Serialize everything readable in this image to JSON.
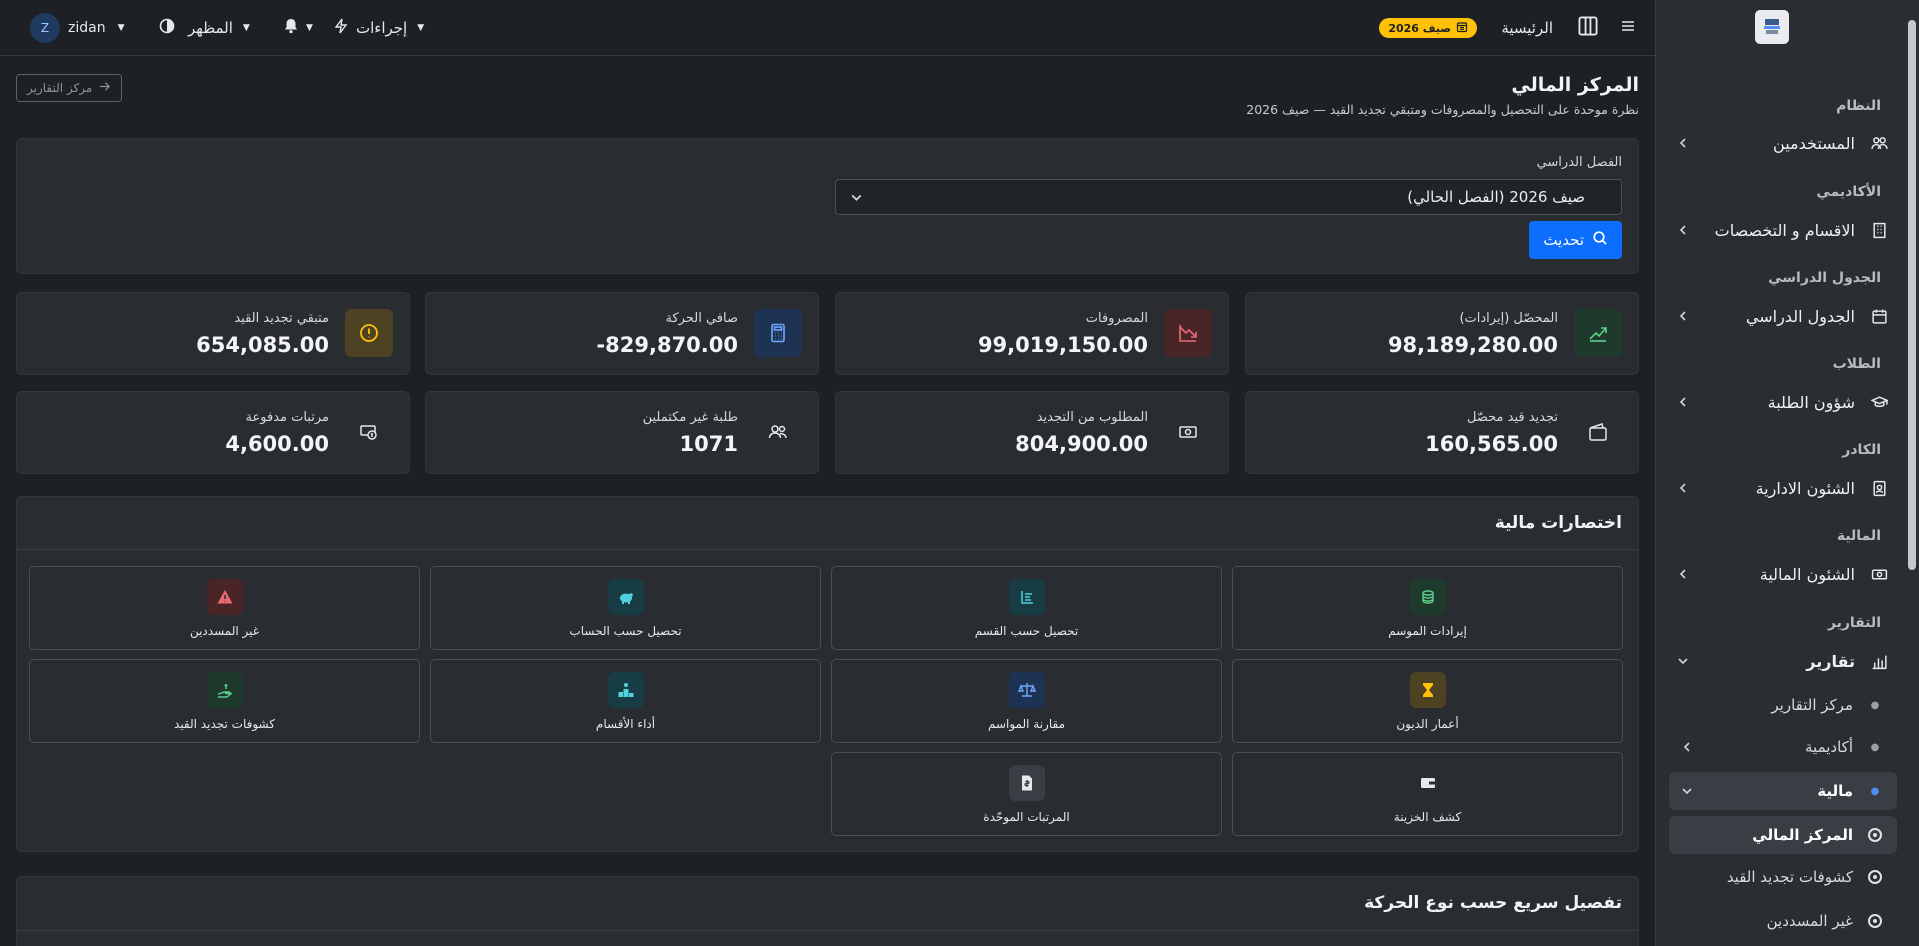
{
  "sidebar": {
    "logo": "university-logo",
    "sections": [
      {
        "title": "النظام",
        "item": "المستخدمين",
        "icon": "users-icon"
      },
      {
        "title": "الأكاديمي",
        "item": "الاقسام و التخصصات",
        "icon": "building-icon"
      },
      {
        "title": "الجدول الدراسي",
        "item": "الجدول الدراسي",
        "icon": "calendar-icon"
      },
      {
        "title": "الطلاب",
        "item": "شؤون الطلبة",
        "icon": "graduation-cap-icon"
      },
      {
        "title": "الكادر",
        "item": "الشئون الادارية",
        "icon": "id-badge-icon"
      },
      {
        "title": "المالية",
        "item": "الشئون المالية",
        "icon": "cash-icon"
      },
      {
        "title": "التقارير",
        "item": "تقارير",
        "icon": "bar-chart-icon"
      }
    ],
    "reports_sub": [
      "مركز التقارير",
      "أكاديمية",
      "مالية"
    ],
    "finance_sub": [
      "المركز المالي",
      "كشوفات تجديد القيد",
      "غير المسددين"
    ]
  },
  "topbar": {
    "home": "الرئيسية",
    "season_badge": "صيف 2026",
    "actions": "إجراءات",
    "appearance": "المظهر",
    "username": "zidan",
    "avatar_letter": "Z"
  },
  "page": {
    "title": "المركز المالي",
    "subtitle": "نظرة موحدة على التحصيل والمصروفات ومتبقي تجديد القيد — صيف 2026",
    "reports_button": "مركز التقارير"
  },
  "filter": {
    "label": "الفصل الدراسي",
    "selected": "صيف 2026 (الفصل الحالي)",
    "refresh": "تحديث"
  },
  "stats": [
    {
      "label": "المحصّل (إيرادات)",
      "value": "98,189,280.00",
      "icon": "trend-up-icon",
      "color": "#1f3a2c",
      "fg": "#5bd08a"
    },
    {
      "label": "المصروفات",
      "value": "99,019,150.00",
      "icon": "trend-down-icon",
      "color": "#4a2528",
      "fg": "#ea6a74"
    },
    {
      "label": "صافي الحركة",
      "value": "829,870.00-",
      "icon": "calculator-icon",
      "color": "#1e3253",
      "fg": "#6ea8ff"
    },
    {
      "label": "متبقي تجديد القيد",
      "value": "654,085.00",
      "icon": "warning-circle-icon",
      "color": "#4d4222",
      "fg": "#ffc107"
    },
    {
      "label": "تجديد قيد محصّل",
      "value": "160,565.00",
      "icon": "wallet-icon",
      "color": "",
      "fg": "#e6e8eb"
    },
    {
      "label": "المطلوب من التجديد",
      "value": "804,900.00",
      "icon": "cash-icon",
      "color": "",
      "fg": "#e6e8eb"
    },
    {
      "label": "طلبة غير مكتملين",
      "value": "1071",
      "icon": "users-icon",
      "color": "",
      "fg": "#e6e8eb"
    },
    {
      "label": "مرتبات مدفوعة",
      "value": "4,600.00",
      "icon": "cash-coin-icon",
      "color": "",
      "fg": "#e6e8eb"
    }
  ],
  "shortcuts": {
    "title": "اختصارات مالية",
    "items": [
      {
        "label": "إيرادات الموسم",
        "icon": "coins-icon",
        "color": "#1e3a2d",
        "fg": "#5bd08a"
      },
      {
        "label": "تحصيل حسب القسم",
        "icon": "list-icon",
        "color": "#183c44",
        "fg": "#4fd1e0"
      },
      {
        "label": "تحصيل حسب الحساب",
        "icon": "piggy-bank-icon",
        "color": "#183c44",
        "fg": "#4fd1e0"
      },
      {
        "label": "غير المسددين",
        "icon": "warning-triangle-icon",
        "color": "#4a2528",
        "fg": "#ea6a74"
      },
      {
        "label": "أعمار الديون",
        "icon": "hourglass-icon",
        "color": "#4d4222",
        "fg": "#ffc107"
      },
      {
        "label": "مقارنة المواسم",
        "icon": "scale-icon",
        "color": "#1e3253",
        "fg": "#6ea8ff"
      },
      {
        "label": "أداء الأقسام",
        "icon": "podium-icon",
        "color": "#183c44",
        "fg": "#4fd1e0"
      },
      {
        "label": "كشوفات تجديد القيد",
        "icon": "hand-cash-icon",
        "color": "#1e3a2d",
        "fg": "#5bd08a"
      },
      {
        "label": "كشف الخزينة",
        "icon": "wallet-icon",
        "color": "",
        "fg": "#e6e8eb"
      },
      {
        "label": "المرتبات الموحّدة",
        "icon": "file-dollar-icon",
        "color": "#3a3e44",
        "fg": "#e6e8eb"
      }
    ]
  },
  "breakdown": {
    "title": "تفصيل سريع حسب نوع الحركة"
  }
}
